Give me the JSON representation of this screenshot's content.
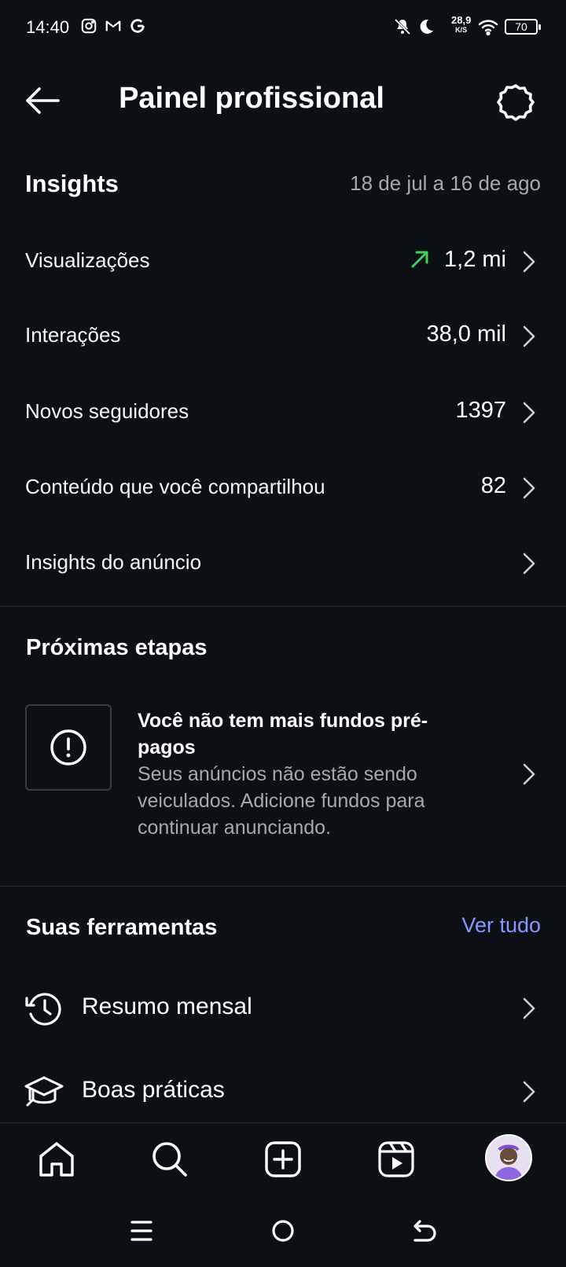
{
  "status_bar": {
    "time": "14:40",
    "speed_value": "28,9",
    "speed_unit": "K/S",
    "battery": "70",
    "left_icons": [
      "instagram-icon",
      "gmail-icon",
      "google-icon"
    ],
    "right_icons": [
      "bell-muted-icon",
      "moon-icon",
      "wifi-icon",
      "battery-icon"
    ]
  },
  "header": {
    "title": "Painel profissional"
  },
  "insights": {
    "heading": "Insights",
    "date_range": "18 de jul a 16 de ago",
    "rows": [
      {
        "label": "Visualizações",
        "value": "1,2 mi",
        "trend": "up"
      },
      {
        "label": "Interações",
        "value": "38,0 mil"
      },
      {
        "label": "Novos seguidores",
        "value": "1397"
      },
      {
        "label": "Conteúdo que você compartilhou",
        "value": "82"
      },
      {
        "label": "Insights do anúncio",
        "value": ""
      }
    ]
  },
  "next_steps": {
    "heading": "Próximas etapas",
    "card": {
      "title": "Você não tem mais fundos pré-pagos",
      "body": "Seus anúncios não estão sendo veiculados. Adicione fundos para continuar anunciando."
    }
  },
  "tools": {
    "heading": "Suas ferramentas",
    "see_all": "Ver tudo",
    "items": [
      {
        "label": "Resumo mensal",
        "icon": "history-icon"
      },
      {
        "label": "Boas práticas",
        "icon": "graduation-cap-icon"
      }
    ]
  },
  "colors": {
    "background": "#0c1014",
    "accent_link": "#8797ff",
    "trend_up": "#3ecf5c",
    "secondary_text": "#a8a8a8"
  }
}
